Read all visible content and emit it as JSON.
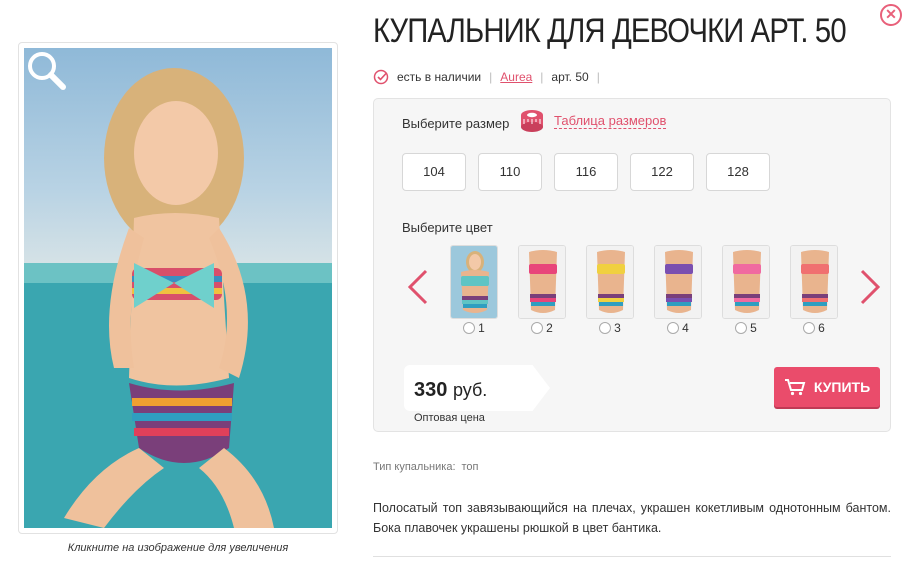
{
  "product": {
    "title": "КУПАЛЬНИК ДЛЯ ДЕВОЧКИ АРТ. 50",
    "stock_status": "есть в наличии",
    "brand": "Aurea",
    "article": "арт. 50",
    "image_caption": "Кликните на изображение для увеличения"
  },
  "size_picker": {
    "label": "Выберите размер",
    "table_link": "Таблица размеров",
    "sizes": [
      "104",
      "110",
      "116",
      "122",
      "128"
    ]
  },
  "color_picker": {
    "label": "Выберите цвет",
    "options": [
      {
        "num": "1",
        "accent": "#5fc4c4"
      },
      {
        "num": "2",
        "accent": "#e8457a"
      },
      {
        "num": "3",
        "accent": "#f0d040"
      },
      {
        "num": "4",
        "accent": "#7a4fb0"
      },
      {
        "num": "5",
        "accent": "#f06aa0"
      },
      {
        "num": "6",
        "accent": "#f07070"
      }
    ]
  },
  "price": {
    "amount": "330",
    "currency": "руб.",
    "note": "Оптовая цена"
  },
  "buy_button": {
    "label": "КУПИТЬ"
  },
  "specs": {
    "label": "Тип купальника:",
    "value": "топ"
  },
  "description": "Полосатый топ завязывающийся на плечах, украшен кокетливым однотонным бантом. Бока плавочек украшены рюшкой в цвет бантика.",
  "colors": {
    "accent": "#e0516d",
    "buy": "#ea4c6b"
  }
}
